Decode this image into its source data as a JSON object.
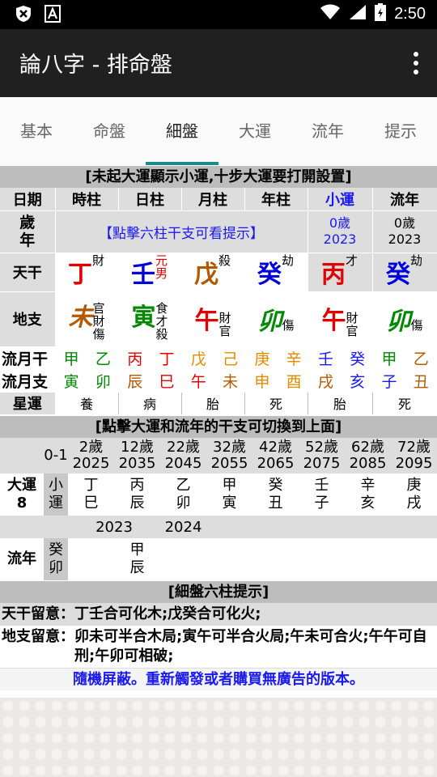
{
  "status": {
    "time": "2:50"
  },
  "app": {
    "title": "論八字 - 排命盤"
  },
  "tabs": [
    "基本",
    "命盤",
    "細盤",
    "大運",
    "流年",
    "提示"
  ],
  "notice_top": "[未起大運顯示小運,十步大運要打開設置]",
  "headers": {
    "date": "日期",
    "hour": "時柱",
    "day": "日柱",
    "month": "月柱",
    "year": "年柱",
    "xiaoyun": "小運",
    "liunian": "流年"
  },
  "labels": {
    "age_year": "歲年",
    "tiangan": "天干",
    "dizhi": "地支",
    "liuyuegan": "流月干",
    "liuyuezhi": "流月支",
    "xingyun": "星運"
  },
  "hint_click": "【點擊六柱干支可看提示】",
  "age": {
    "xiaoyun_age": "0歲",
    "xiaoyun_year": "2023",
    "liunian_age": "0歲",
    "liunian_year": "2023"
  },
  "stems": [
    {
      "char": "丁",
      "god": "財",
      "color": "#e00000"
    },
    {
      "char": "壬",
      "god": "元男",
      "color": "#0000dd"
    },
    {
      "char": "戊",
      "god": "殺",
      "color": "#b25900"
    },
    {
      "char": "癸",
      "god": "劫",
      "color": "#0000dd"
    },
    {
      "char": "丙",
      "god": "才",
      "color": "#e00000"
    },
    {
      "char": "癸",
      "god": "劫",
      "color": "#0000dd"
    }
  ],
  "branches": [
    {
      "char": "未",
      "hidden": [
        "官",
        "財",
        "傷"
      ],
      "color": "#b25900"
    },
    {
      "char": "寅",
      "hidden": [
        "食",
        "才",
        "殺"
      ],
      "color": "#008800"
    },
    {
      "char": "午",
      "hidden": [
        "財",
        "官"
      ],
      "color": "#e00000"
    },
    {
      "char": "卯",
      "hidden": [
        "傷"
      ],
      "color": "#008800"
    },
    {
      "char": "午",
      "hidden": [
        "財",
        "官"
      ],
      "color": "#e00000"
    },
    {
      "char": "卯",
      "hidden": [
        "傷"
      ],
      "color": "#008800"
    }
  ],
  "month_stems": [
    {
      "c": "甲",
      "color": "#008800"
    },
    {
      "c": "乙",
      "color": "#008800"
    },
    {
      "c": "丙",
      "color": "#e00000"
    },
    {
      "c": "丁",
      "color": "#e00000"
    },
    {
      "c": "戊",
      "color": "#e08a00"
    },
    {
      "c": "己",
      "color": "#e08a00"
    },
    {
      "c": "庚",
      "color": "#e08a00"
    },
    {
      "c": "辛",
      "color": "#e08a00"
    },
    {
      "c": "壬",
      "color": "#1a1aee"
    },
    {
      "c": "癸",
      "color": "#1a1aee"
    },
    {
      "c": "甲",
      "color": "#008800"
    },
    {
      "c": "乙",
      "color": "#b25900"
    }
  ],
  "month_branches": [
    {
      "c": "寅",
      "color": "#008800"
    },
    {
      "c": "卯",
      "color": "#008800"
    },
    {
      "c": "辰",
      "color": "#b25900"
    },
    {
      "c": "巳",
      "color": "#e00000"
    },
    {
      "c": "午",
      "color": "#e00000"
    },
    {
      "c": "未",
      "color": "#b25900"
    },
    {
      "c": "申",
      "color": "#e08a00"
    },
    {
      "c": "酉",
      "color": "#e08a00"
    },
    {
      "c": "戌",
      "color": "#b25900"
    },
    {
      "c": "亥",
      "color": "#1a1aee"
    },
    {
      "c": "子",
      "color": "#1a1aee"
    },
    {
      "c": "丑",
      "color": "#b25900"
    }
  ],
  "xingyun": [
    "養",
    "病",
    "胎",
    "死",
    "胎",
    "死"
  ],
  "notice_mid": "[點擊大運和流年的干支可切換到上面]",
  "dayun_head": [
    {
      "age": "0-1",
      "year": ""
    },
    {
      "age": "2歲",
      "year": "2025"
    },
    {
      "age": "12歲",
      "year": "2035"
    },
    {
      "age": "22歲",
      "year": "2045"
    },
    {
      "age": "32歲",
      "year": "2055"
    },
    {
      "age": "42歲",
      "year": "2065"
    },
    {
      "age": "52歲",
      "year": "2075"
    },
    {
      "age": "62歲",
      "year": "2085"
    },
    {
      "age": "72歲",
      "year": "2095"
    }
  ],
  "dayun_label": "大運",
  "dayun_num": "8",
  "dayun_cells": [
    {
      "t": "小",
      "b": "運"
    },
    {
      "t": "丁",
      "b": "巳"
    },
    {
      "t": "丙",
      "b": "辰"
    },
    {
      "t": "乙",
      "b": "卯"
    },
    {
      "t": "甲",
      "b": "寅"
    },
    {
      "t": "癸",
      "b": "丑"
    },
    {
      "t": "壬",
      "b": "子"
    },
    {
      "t": "辛",
      "b": "亥"
    },
    {
      "t": "庚",
      "b": "戌"
    }
  ],
  "liunian_years": [
    "2023",
    "2024"
  ],
  "liunian_label": "流年",
  "liunian_cells": [
    {
      "t": "癸",
      "b": "卯"
    },
    {
      "t": "甲",
      "b": "辰"
    }
  ],
  "notice_tip": "[細盤六柱提示]",
  "tip_tiangan_label": "天干留意：",
  "tip_tiangan": "丁壬合可化木;戊癸合可化火;",
  "tip_dizhi_label": "地支留意：",
  "tip_dizhi": "卯未可半合木局;寅午可半合火局;午未可合火;午午可自刑;午卯可相破;",
  "ad_text": "隨機屏蔽。重新觸發或者購買無廣告的版本。"
}
